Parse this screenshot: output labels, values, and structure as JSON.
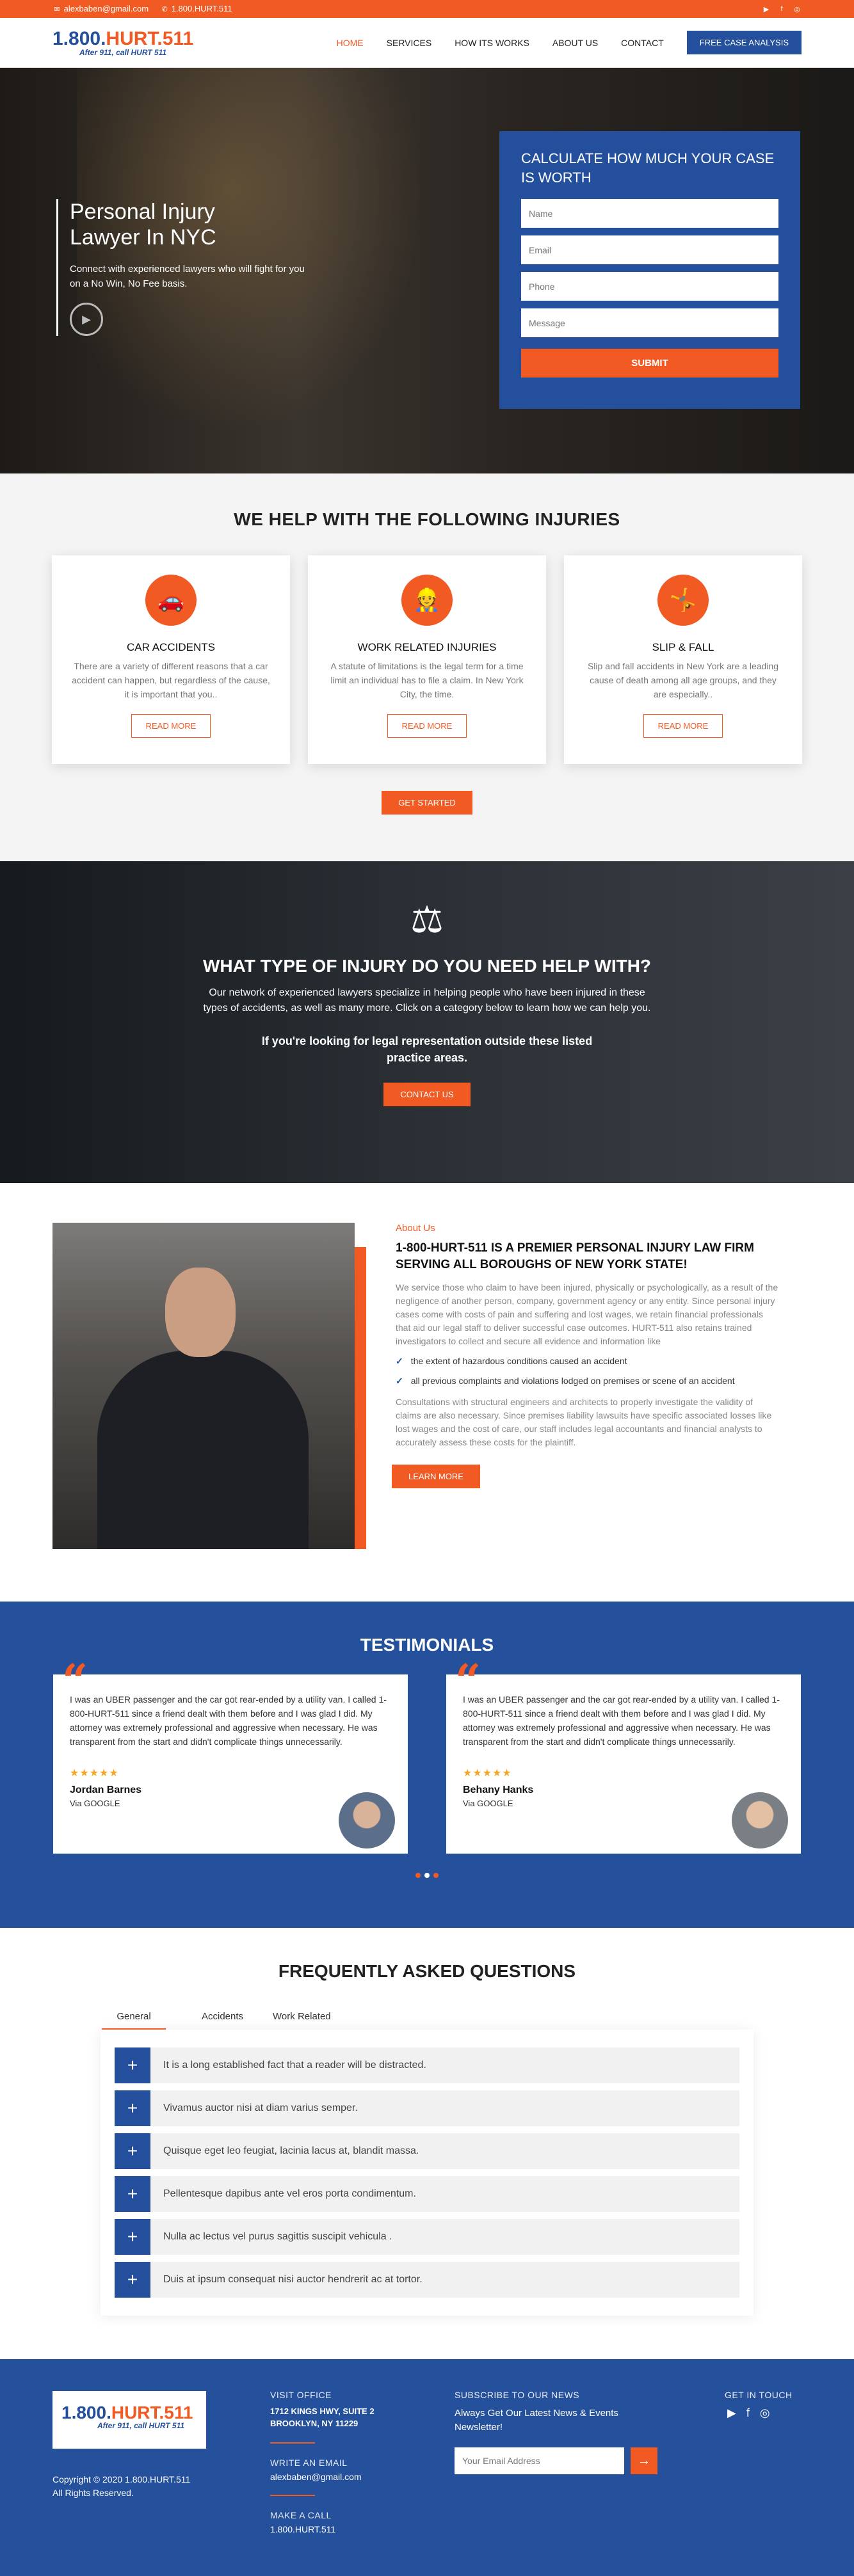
{
  "topbar": {
    "email": "alexbaben@gmail.com",
    "phone": "1.800.HURT.511"
  },
  "logo": {
    "prefix": "1.800.",
    "name": "HURT.511",
    "tagline": "After 911, call HURT 511"
  },
  "nav": {
    "items": [
      "HOME",
      "SERVICES",
      "HOW ITS WORKS",
      "ABOUT US",
      "CONTACT"
    ],
    "cta": "FREE CASE ANALYSIS"
  },
  "hero": {
    "title_line1": "Personal Injury",
    "title_line2": "Lawyer In NYC",
    "subtitle": "Connect with experienced lawyers who will fight for you on a No Win, No Fee basis."
  },
  "form": {
    "title": "CALCULATE HOW MUCH YOUR CASE IS WORTH",
    "name_placeholder": "Name",
    "email_placeholder": "Email",
    "phone_placeholder": "Phone",
    "message_placeholder": "Message",
    "submit": "SUBMIT"
  },
  "injuries": {
    "title": "WE HELP WITH THE FOLLOWING INJURIES",
    "cards": [
      {
        "title": "CAR ACCIDENTS",
        "text": "There are a variety of different reasons that a car accident can happen, but regardless of the cause, it is important that you..",
        "button": "READ MORE"
      },
      {
        "title": "WORK RELATED INJURIES",
        "text": "A statute of limitations is the legal term for a time limit an individual has to file a claim. In New York City, the time.",
        "button": "READ MORE"
      },
      {
        "title": "SLIP & FALL",
        "text": "Slip and fall accidents in New York are a leading cause of death among all age groups, and they are especially..",
        "button": "READ MORE"
      }
    ],
    "cta": "GET STARTED"
  },
  "help": {
    "title": "WHAT TYPE OF INJURY DO YOU NEED HELP WITH?",
    "text": "Our network of experienced lawyers specialize in helping people who have been injured in these types of accidents, as well as many more. Click on a category below to learn how we can help you.",
    "subtext": "If you're looking for legal representation outside these listed practice areas.",
    "cta": "CONTACT US"
  },
  "about": {
    "kicker": "About Us",
    "title": "1-800-HURT-511 IS A PREMIER PERSONAL INJURY LAW FIRM SERVING ALL BOROUGHS OF NEW YORK STATE!",
    "para1": "We service those who claim to have been injured, physically or psychologically, as a result of the negligence of another person, company, government agency or any entity. Since personal injury cases come with costs of pain and suffering and lost wages, we retain financial professionals that aid our legal staff to deliver successful case outcomes. HURT-511 also retains trained investigators to collect and secure all evidence and information like",
    "checks": [
      "the extent of hazardous conditions caused an accident",
      "all previous complaints and violations lodged on premises or scene of an accident"
    ],
    "para2": "Consultations with structural engineers and architects to properly investigate the validity of claims are also necessary. Since premises liability lawsuits have specific associated losses like lost wages and the cost of care, our staff includes legal accountants and financial analysts to accurately assess these costs for the plaintiff.",
    "cta": "LEARN MORE"
  },
  "testimonials": {
    "title": "TESTIMONIALS",
    "items": [
      {
        "text": "I was an UBER passenger and the car got rear-ended by a utility van. I called 1-800-HURT-511 since a friend dealt with them before and I was glad I did. My attorney was extremely professional and aggressive when necessary. He was transparent from the start and didn't complicate things unnecessarily.",
        "stars": "★★★★★",
        "name": "Jordan Barnes",
        "via": "Via GOOGLE"
      },
      {
        "text": "I was an UBER passenger and the car got rear-ended by a utility van. I called 1-800-HURT-511 since a friend dealt with them before and I was glad I did. My attorney was extremely professional and aggressive when necessary. He was transparent from the start and didn't complicate things unnecessarily.",
        "stars": "★★★★★",
        "name": "Behany Hanks",
        "via": "Via GOOGLE"
      }
    ]
  },
  "faq": {
    "title": "FREQUENTLY ASKED QUESTIONS",
    "tabs": [
      "General",
      "Accidents",
      "Work Related"
    ],
    "items": [
      "It is a long established fact that a reader will be distracted.",
      "Vivamus auctor nisi at diam varius semper.",
      "Quisque eget leo feugiat, lacinia lacus at, blandit massa.",
      "Pellentesque dapibus ante vel eros porta condimentum.",
      "Nulla ac lectus vel purus sagittis suscipit vehicula .",
      "Duis at ipsum consequat nisi auctor hendrerit ac at tortor."
    ]
  },
  "footer": {
    "copyright_line1": "Copyright © 2020 1.800.HURT.511",
    "copyright_line2": "All Rights Reserved.",
    "visit_title": "VISIT OFFICE",
    "address1": "1712 KINGS HWY, SUITE 2",
    "address2": "BROOKLYN, NY 11229",
    "email_title": "WRITE AN EMAIL",
    "email": "alexbaben@gmail.com",
    "call_title": "MAKE A CALL",
    "phone": "1.800.HURT.511",
    "subscribe_title": "SUBSCRIBE TO OUR NEWS",
    "subscribe_text": "Always Get Our Latest News & Events Newsletter!",
    "subscribe_placeholder": "Your Email Address",
    "touch_title": "GET IN TOUCH"
  },
  "colors": {
    "accent": "#f15a22",
    "brand": "#24509c"
  }
}
